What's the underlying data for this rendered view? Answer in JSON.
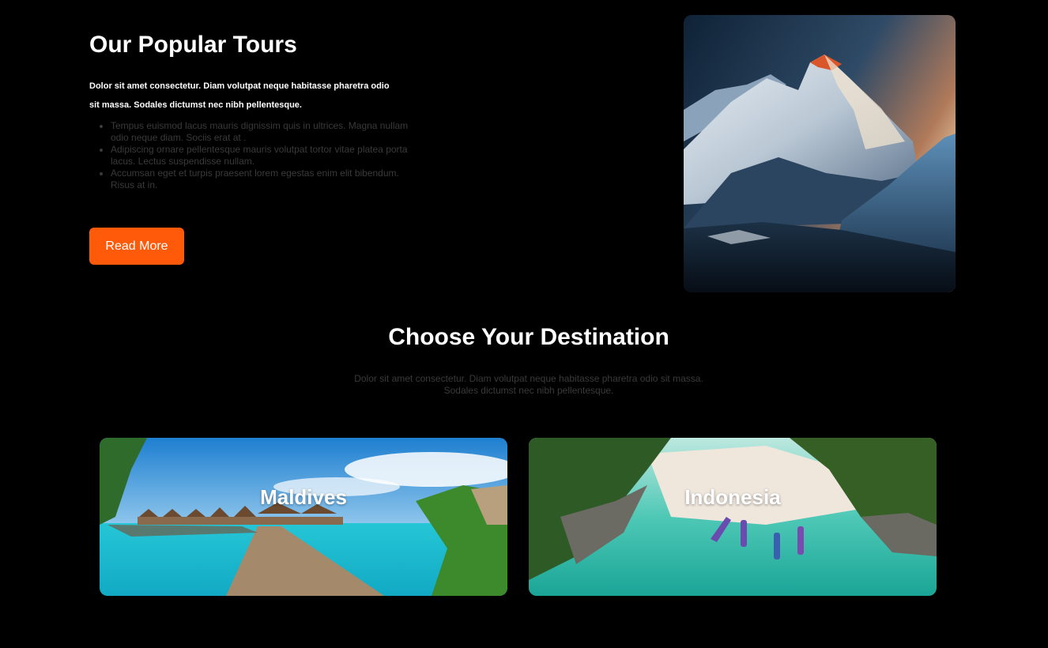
{
  "tours": {
    "title": "Our Popular Tours",
    "intro": "Dolor sit amet consectetur. Diam volutpat neque habitasse pharetra odio sit massa. Sodales dictumst nec nibh pellentesque.",
    "bullets": [
      "Tempus euismod lacus mauris dignissim quis in ultrices. Magna nullam odio neque diam. Sociis erat at .",
      "Adipiscing ornare pellentesque mauris volutpat tortor vitae platea porta lacus. Lectus suspendisse nullam.",
      "Accumsan eget et turpis praesent lorem egestas enim elit bibendum. Risus at in."
    ],
    "button_label": "Read More",
    "image_icon": "mountain-image"
  },
  "destinations": {
    "title": "Choose Your Destination",
    "subtitle": "Dolor sit amet consectetur. Diam volutpat neque habitasse pharetra odio sit massa. Sodales dictumst nec nibh pellentesque.",
    "cards": [
      {
        "label": "Maldives",
        "image_icon": "maldives-image"
      },
      {
        "label": "Indonesia",
        "image_icon": "indonesia-image"
      }
    ]
  },
  "colors": {
    "background": "#000000",
    "accent": "#ff5a0a",
    "muted_text": "#3a3a3a"
  }
}
